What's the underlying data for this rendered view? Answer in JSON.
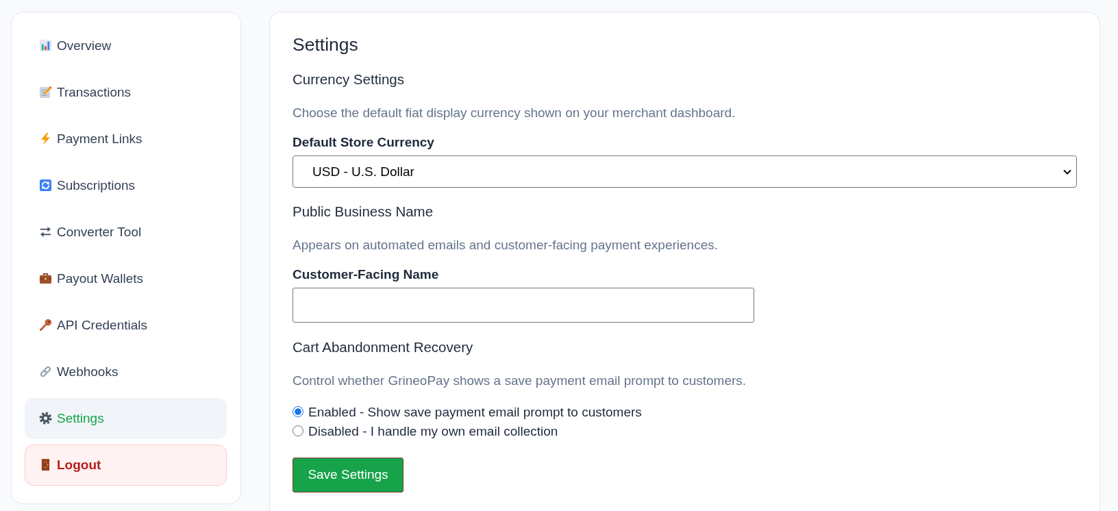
{
  "sidebar": {
    "items": [
      {
        "label": "Overview",
        "selected": false
      },
      {
        "label": "Transactions",
        "selected": false
      },
      {
        "label": "Payment Links",
        "selected": false
      },
      {
        "label": "Subscriptions",
        "selected": false
      },
      {
        "label": "Converter Tool",
        "selected": false
      },
      {
        "label": "Payout Wallets",
        "selected": false
      },
      {
        "label": "API Credentials",
        "selected": false
      },
      {
        "label": "Webhooks",
        "selected": false
      },
      {
        "label": "Settings",
        "selected": true
      }
    ],
    "logout_button": {
      "label": "Logout"
    }
  },
  "main": {
    "title": "Settings",
    "sections": [
      {
        "heading": "Currency Settings",
        "description": "Choose the default fiat display currency shown on your merchant dashboard.",
        "field": {
          "kind": "select",
          "label": "Default Store Currency",
          "value": "USD - U.S. Dollar"
        }
      },
      {
        "heading": "Public Business Name",
        "description": "Appears on automated emails and customer-facing payment experiences.",
        "field": {
          "kind": "text",
          "label": "Customer-Facing Name"
        }
      },
      {
        "heading": "Cart Abandonment Recovery",
        "description": "Control whether GrineoPay shows a save payment email prompt to customers.",
        "field": {
          "kind": "radio",
          "options": [
            {
              "label": "Enabled - Show save payment email prompt to customers",
              "selected": true
            },
            {
              "label": "Disabled - I handle my own email collection",
              "selected": false
            }
          ]
        }
      }
    ],
    "save_button": {
      "label": "Save Settings"
    }
  }
}
